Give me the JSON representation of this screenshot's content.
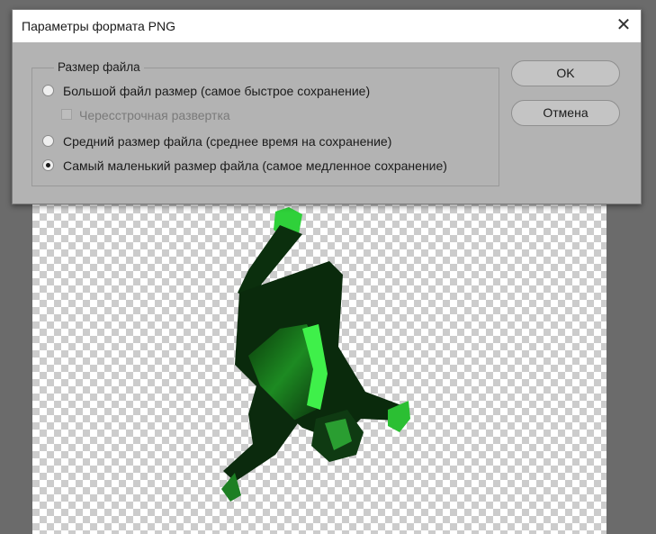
{
  "dialog": {
    "title": "Параметры формата PNG",
    "close_icon": "close-icon",
    "group_label": "Размер файла",
    "options": [
      {
        "label": "Большой файл размер (самое быстрое сохранение)",
        "checked": false
      },
      {
        "label": "Средний размер файла (среднее время на сохранение)",
        "checked": false
      },
      {
        "label": "Самый маленький размер файла (самое медленное сохранение)",
        "checked": true
      }
    ],
    "interlaced": {
      "label": "Чересстрочная развертка",
      "checked": false,
      "enabled": false
    },
    "ok_label": "OK",
    "cancel_label": "Отмена"
  },
  "colors": {
    "workspace": "#6b6b6b",
    "dialog_bg": "#b3b3b3",
    "titlebar_bg": "#ffffff",
    "figure_glow": "#22d62a"
  }
}
